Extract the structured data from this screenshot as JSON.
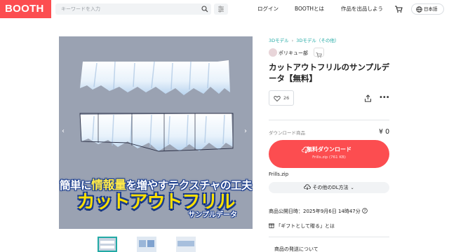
{
  "header": {
    "logo": "BOOTH",
    "search_placeholder": "キーワードを入力",
    "nav": [
      "ログイン",
      "BOOTHとは",
      "作品を出品しよう"
    ],
    "language": "日本語",
    "icons": [
      "search-icon",
      "filter-icon",
      "cart-icon",
      "globe-icon"
    ]
  },
  "gallery": {
    "banner_line1_a": "簡単に",
    "banner_line1_b": "情報量",
    "banner_line1_c": "を増やすテクスチャの工夫",
    "banner_line2": "カットアウトフリル",
    "banner_line3": "サンプルデータ",
    "prev_arrow": "‹",
    "next_arrow": "›",
    "thumbnail_count": 3,
    "active_thumbnail": 0
  },
  "product": {
    "breadcrumbs": [
      "3Dモデル",
      "3Dモデル（その他）"
    ],
    "shop_name": "ポリキュー部",
    "title": "カットアウトフリルのサンプルデータ【無料】",
    "like_count": "26",
    "download_label": "ダウンロード商品",
    "price": "¥ 0",
    "download_button": "無料ダウンロード",
    "download_file_info": "Frills.zip (761 KB)",
    "filename": "Frills.zip",
    "other_dl": "その他のDL方法",
    "published": "商品公開日時：2025年9月6日 14時47分",
    "gift": "「ギフトとして贈る」とは",
    "shipping_heading": "商品の発送について"
  },
  "colors": {
    "brand": "#fc4d50",
    "link": "#22aaa5",
    "image_bg": "#9aa2b2"
  }
}
